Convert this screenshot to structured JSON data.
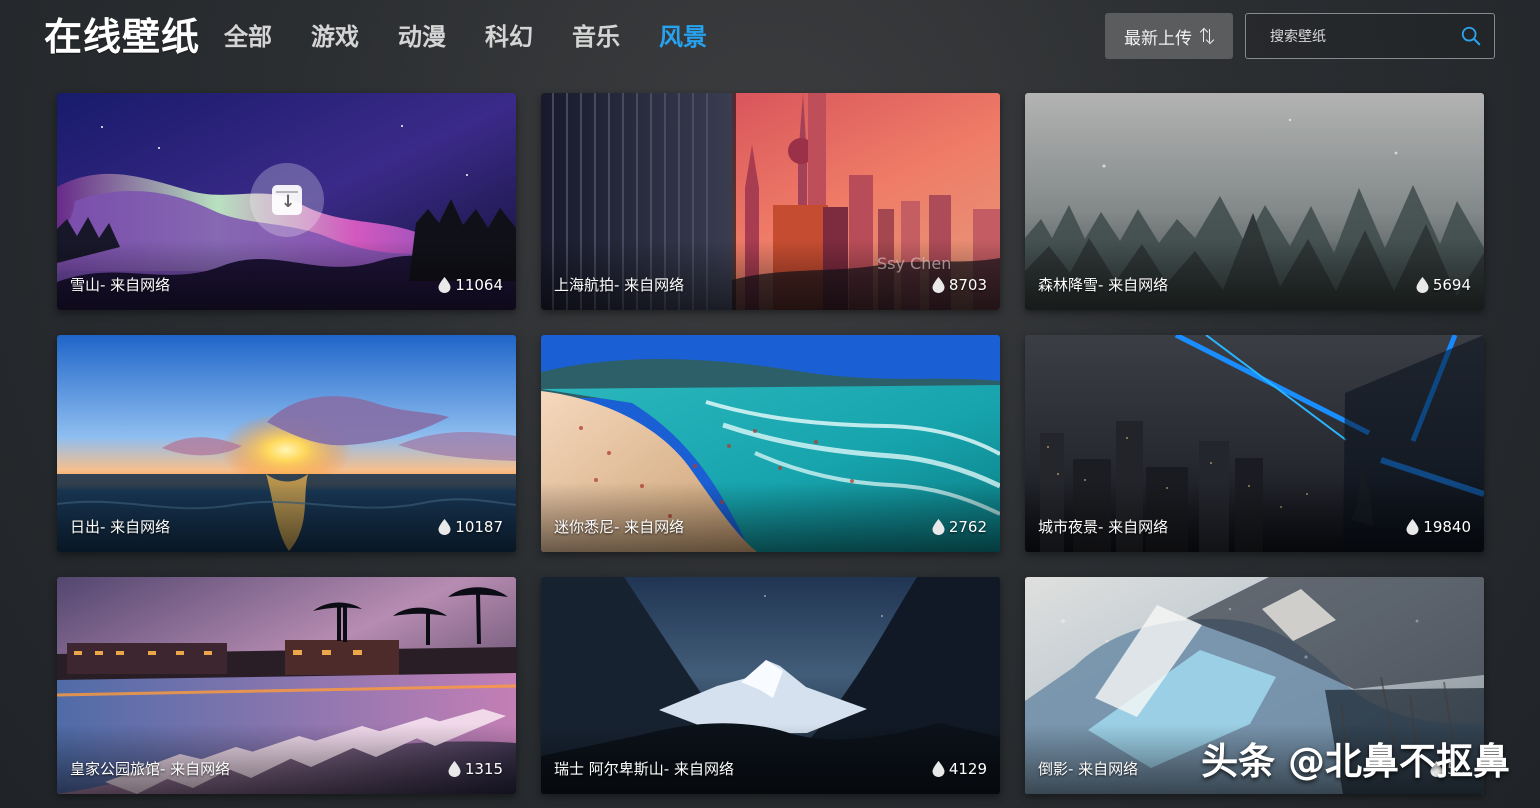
{
  "brand": {
    "title": "在线壁纸"
  },
  "nav": {
    "items": [
      {
        "label": "全部",
        "active": false
      },
      {
        "label": "游戏",
        "active": false
      },
      {
        "label": "动漫",
        "active": false
      },
      {
        "label": "科幻",
        "active": false
      },
      {
        "label": "音乐",
        "active": false
      },
      {
        "label": "风景",
        "active": true
      }
    ]
  },
  "toolbar": {
    "sort_label": "最新上传",
    "sort_icon": "sort-icon"
  },
  "search": {
    "placeholder": "搜索壁纸",
    "value": "",
    "icon": "search-icon"
  },
  "colors": {
    "accent": "#27a2ef",
    "text": "#ffffff",
    "nav_inactive": "#d5d5d5",
    "sort_background": "#5b5c5e"
  },
  "wallpapers": [
    {
      "title": "雪山- 来自网络",
      "views": "11064",
      "download_icon": "download-icon"
    },
    {
      "title": "上海航拍- 来自网络",
      "views": "8703"
    },
    {
      "title": "森林降雪- 来自网络",
      "views": "5694"
    },
    {
      "title": "日出- 来自网络",
      "views": "10187"
    },
    {
      "title": "迷你悉尼- 来自网络",
      "views": "2762"
    },
    {
      "title": "城市夜景- 来自网络",
      "views": "19840"
    },
    {
      "title": "皇家公园旅馆- 来自网络",
      "views": "1315"
    },
    {
      "title": "瑞士 阿尔卑斯山- 来自网络",
      "views": "4129"
    },
    {
      "title": "倒影- 来自网络",
      "views": "5..."
    }
  ],
  "watermark": {
    "text": "头条 @北鼻不抠鼻"
  }
}
